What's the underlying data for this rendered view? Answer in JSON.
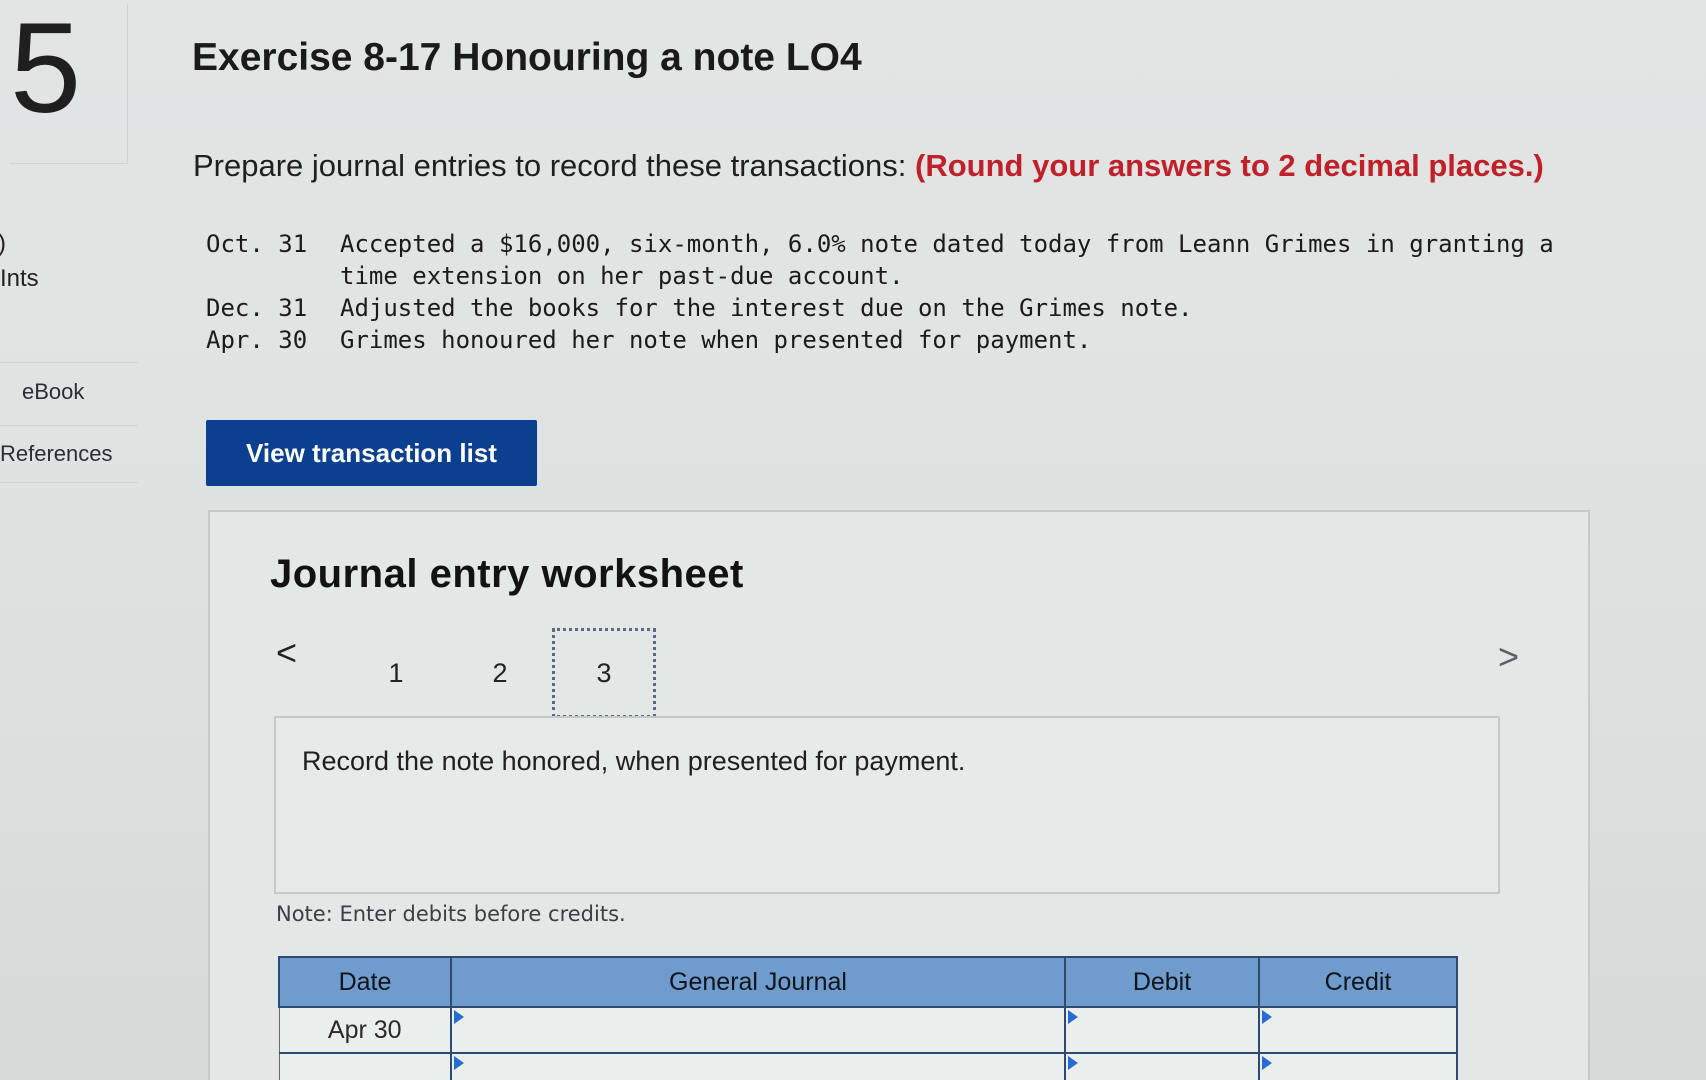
{
  "left_rail": {
    "question_number": "5",
    "points_mark": ")",
    "points_label": "Ints",
    "ebook_label": "eBook",
    "references_label": "References"
  },
  "header": {
    "title": "Exercise 8-17 Honouring a note LO4"
  },
  "instructions": {
    "text": "Prepare journal entries to record these transactions:",
    "emphasis": "(Round your answers to 2 decimal places.)"
  },
  "transactions": [
    {
      "date": "Oct. 31",
      "description": "Accepted a $16,000, six-month, 6.0% note dated today from Leann Grimes in granting a time extension on her past-due account."
    },
    {
      "date": "Dec. 31",
      "description": "Adjusted the books for the interest due on the Grimes note."
    },
    {
      "date": "Apr. 30",
      "description": "Grimes honoured her note when presented for payment."
    }
  ],
  "view_transaction_button": "View transaction list",
  "worksheet": {
    "title": "Journal entry worksheet",
    "prev_symbol": "<",
    "next_symbol": ">",
    "tabs": [
      "1",
      "2",
      "3"
    ],
    "active_tab": "3",
    "instruction": "Record the note honored, when presented for payment.",
    "note": "Note: Enter debits before credits.",
    "table": {
      "headers": {
        "date": "Date",
        "general_journal": "General Journal",
        "debit": "Debit",
        "credit": "Credit"
      },
      "rows": [
        {
          "date": "Apr 30",
          "account": "",
          "debit": "",
          "credit": ""
        },
        {
          "date": "",
          "account": "",
          "debit": "",
          "credit": ""
        }
      ]
    }
  },
  "colors": {
    "accent_button": "#0b3f8f",
    "emphasis_red": "#c0202a",
    "table_header": "#6f9ccd"
  }
}
